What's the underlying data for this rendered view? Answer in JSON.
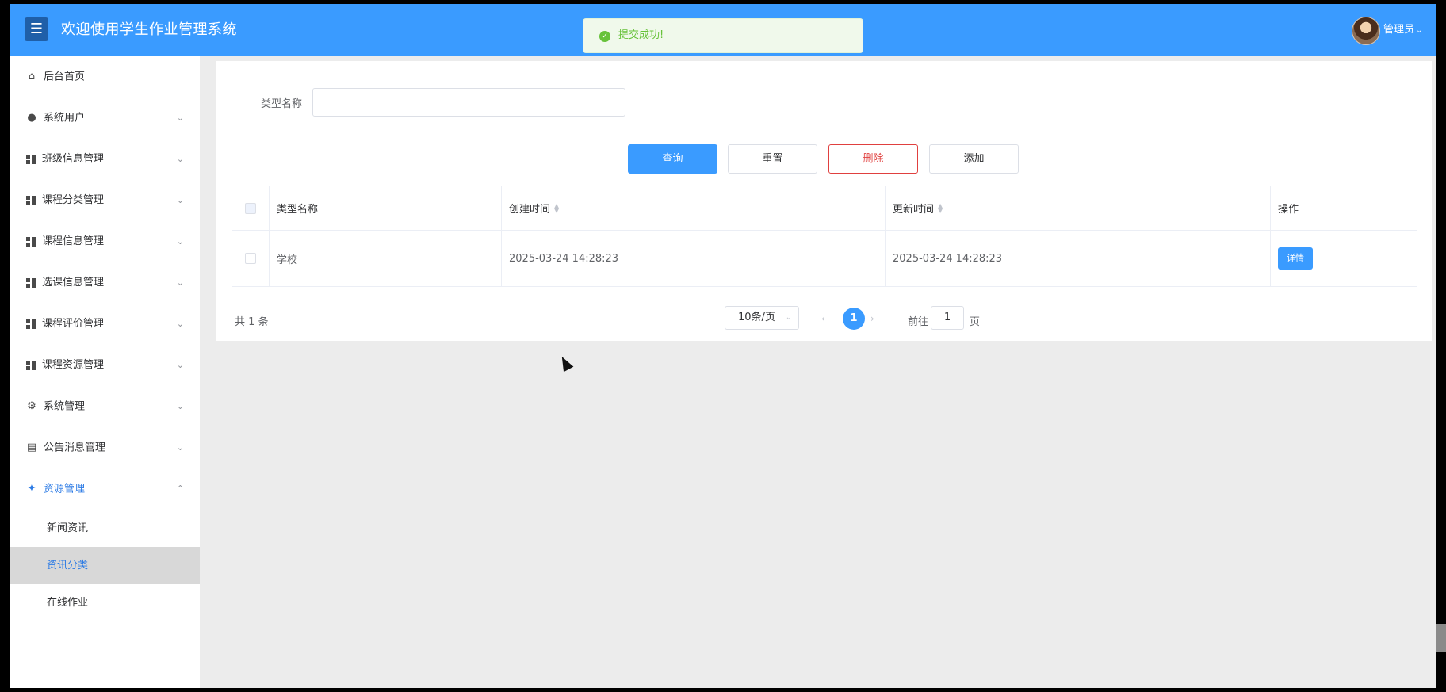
{
  "header": {
    "menu_icon": "☰",
    "title": "欢迎使用学生作业管理系统",
    "user": "管理员",
    "user_caret": "⌄"
  },
  "toast": {
    "icon": "✓",
    "message": "提交成功!"
  },
  "sidebar": {
    "items": [
      {
        "label": "后台首页",
        "icon": "home-icon",
        "arrow": ""
      },
      {
        "label": "系统用户",
        "icon": "user-icon",
        "arrow": "⌄"
      },
      {
        "label": "班级信息管理",
        "icon": "grid-icon",
        "arrow": "⌄"
      },
      {
        "label": "课程分类管理",
        "icon": "grid-icon",
        "arrow": "⌄"
      },
      {
        "label": "课程信息管理",
        "icon": "grid-icon",
        "arrow": "⌄"
      },
      {
        "label": "选课信息管理",
        "icon": "grid-icon",
        "arrow": "⌄"
      },
      {
        "label": "课程评价管理",
        "icon": "grid-icon",
        "arrow": "⌄"
      },
      {
        "label": "课程资源管理",
        "icon": "grid-icon",
        "arrow": "⌄"
      },
      {
        "label": "系统管理",
        "icon": "gear-icon",
        "arrow": "⌄"
      },
      {
        "label": "公告消息管理",
        "icon": "document-icon",
        "arrow": "⌄"
      },
      {
        "label": "资源管理",
        "icon": "compass-icon",
        "arrow": "⌃"
      }
    ],
    "subitems": [
      "新闻资讯",
      "资讯分类",
      "在线作业"
    ],
    "active_subitem": "资讯分类"
  },
  "search": {
    "label": "类型名称",
    "value": ""
  },
  "buttons": {
    "query": "查询",
    "reset": "重置",
    "delete": "删除",
    "add": "添加"
  },
  "table": {
    "columns": [
      "类型名称",
      "创建时间",
      "更新时间",
      "操作"
    ],
    "rows": [
      {
        "name": "学校",
        "created": "2025-03-24 14:28:23",
        "updated": "2025-03-24 14:28:23",
        "action": "详情"
      }
    ]
  },
  "pagination": {
    "total": "共 1 条",
    "page_size": "10条/页",
    "current_page": "1",
    "goto_label": "前往",
    "goto_value": "1",
    "goto_suffix": "页",
    "prev": "‹",
    "next": "›"
  },
  "colors": {
    "primary": "#3a9bff",
    "danger": "#e0403f",
    "success": "#67c23a"
  }
}
